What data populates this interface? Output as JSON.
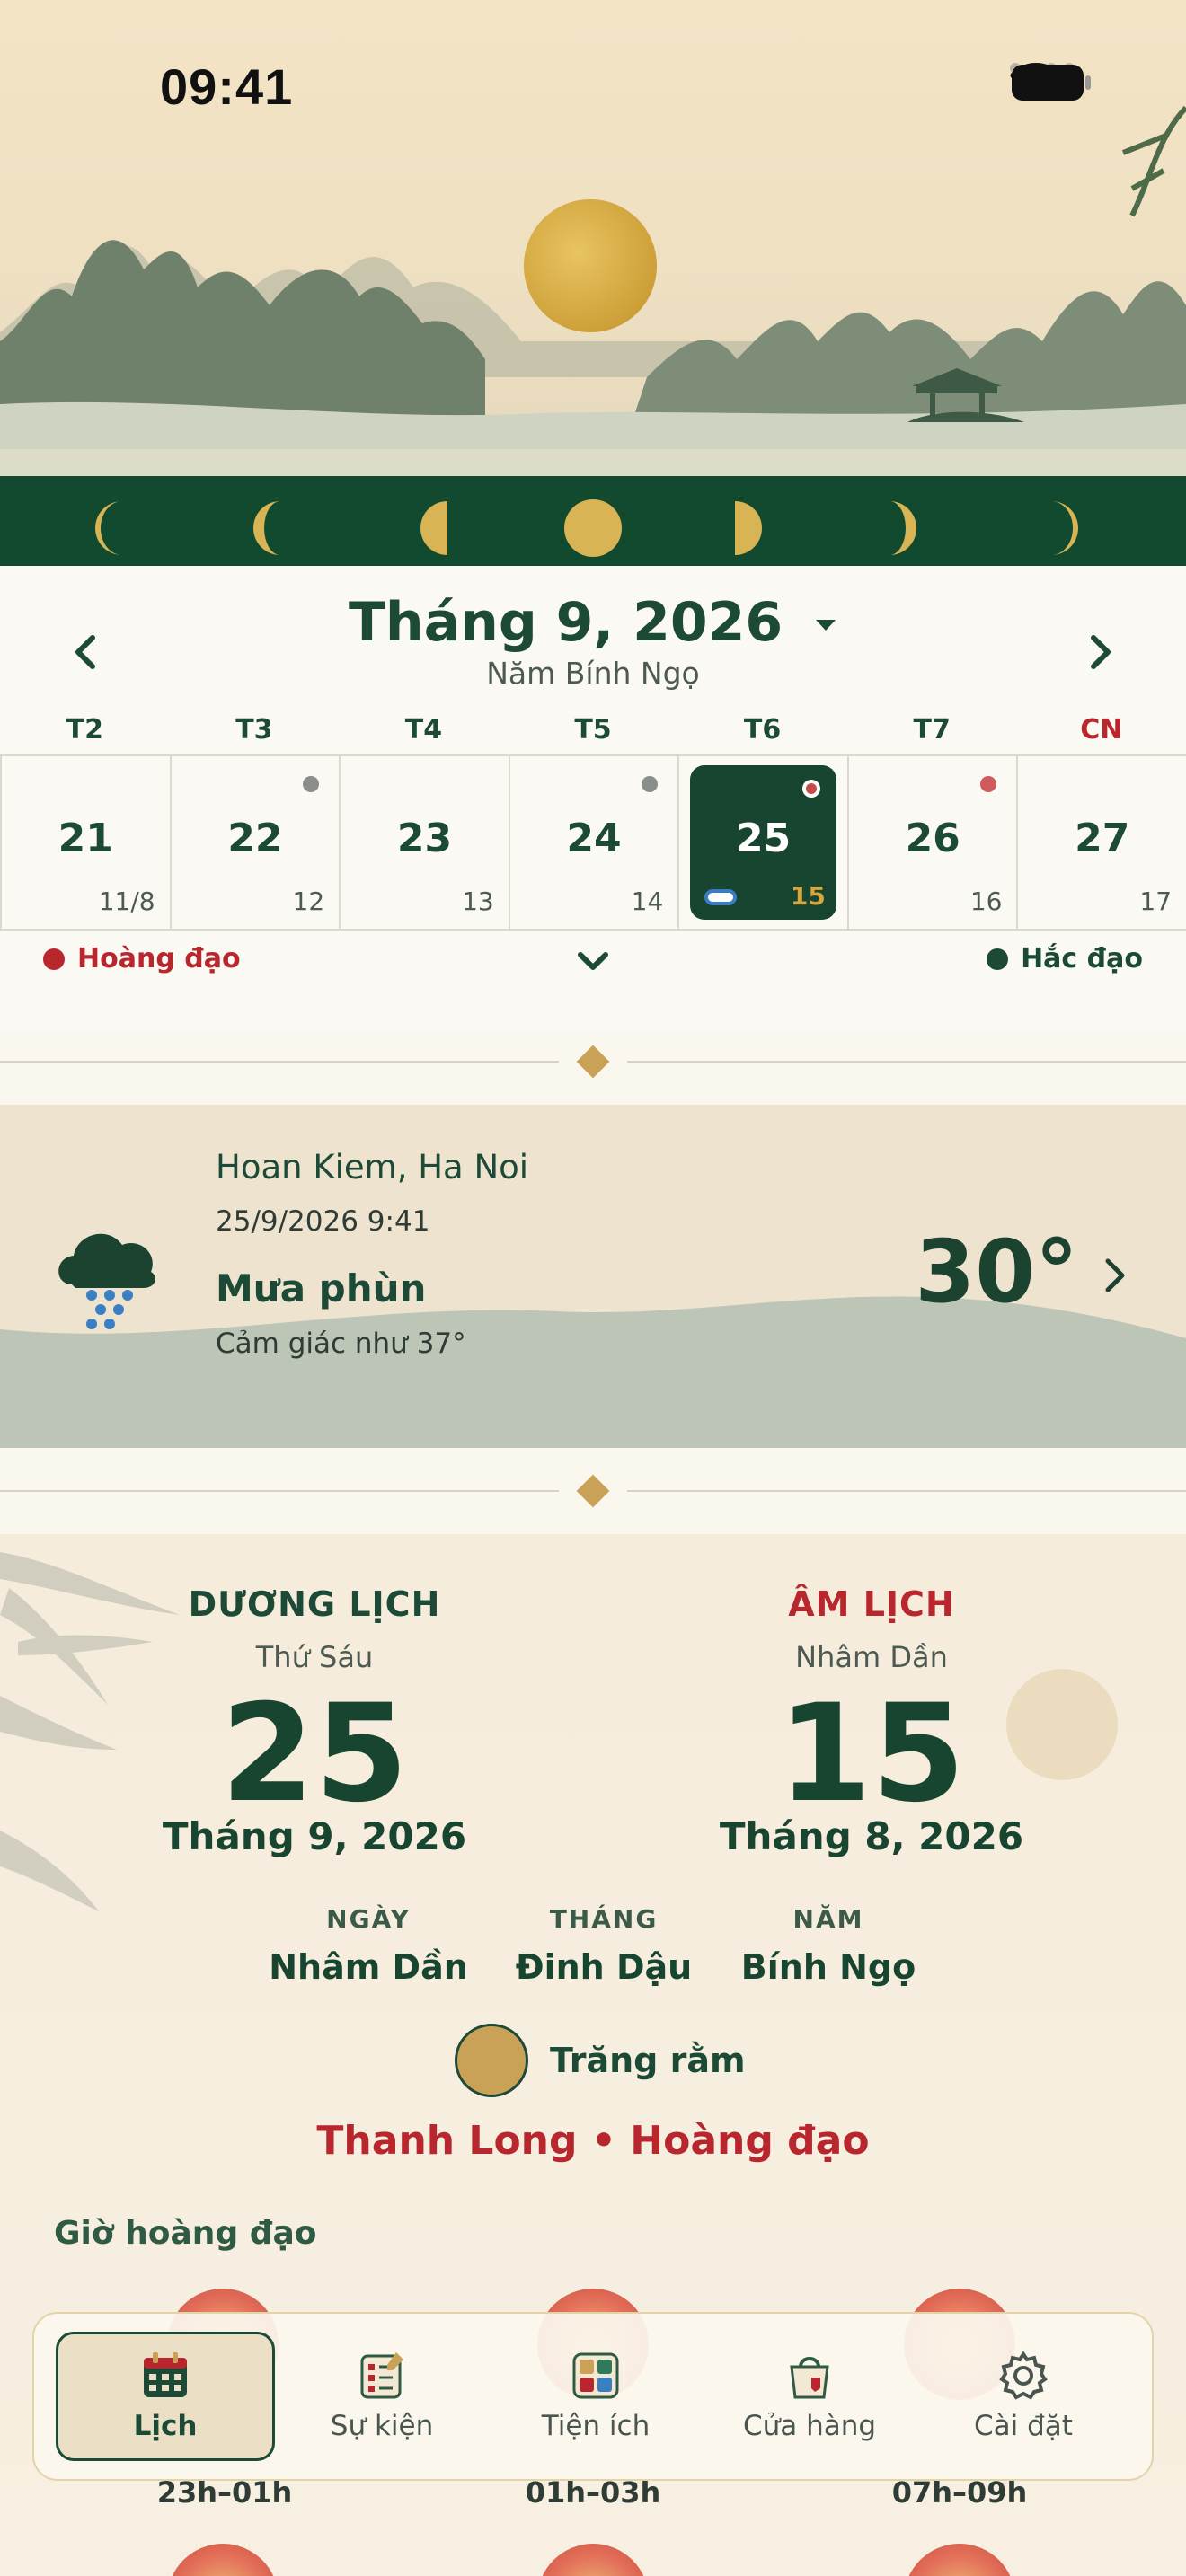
{
  "status_bar": {
    "time": "09:41"
  },
  "calendar": {
    "month_title": "Tháng 9, 2026",
    "year_label": "Năm Bính Ngọ",
    "weekdays": [
      "T2",
      "T3",
      "T4",
      "T5",
      "T6",
      "T7",
      "CN"
    ],
    "days": [
      {
        "day": "21",
        "lunar": "11/8",
        "dot": ""
      },
      {
        "day": "22",
        "lunar": "12",
        "dot": "grey"
      },
      {
        "day": "23",
        "lunar": "13",
        "dot": ""
      },
      {
        "day": "24",
        "lunar": "14",
        "dot": "grey"
      },
      {
        "day": "25",
        "lunar": "15",
        "dot": "red",
        "selected": true
      },
      {
        "day": "26",
        "lunar": "16",
        "dot": "red"
      },
      {
        "day": "27",
        "lunar": "17",
        "dot": ""
      }
    ],
    "legend_good": "Hoàng đạo",
    "legend_bad": "Hắc đạo",
    "colors": {
      "good": "#b8262e",
      "bad": "#1d4a36",
      "accent": "#17452f"
    }
  },
  "weather": {
    "location": "Hoan Kiem, Ha Noi",
    "datetime": "25/9/2026 9:41",
    "condition": "Mưa phùn",
    "feels_like": "Cảm giác như 37°",
    "temperature": "30°",
    "icon": "drizzle-cloud-icon"
  },
  "day_detail": {
    "solar": {
      "header": "DƯƠNG LỊCH",
      "weekday": "Thứ Sáu",
      "day": "25",
      "month_year": "Tháng 9, 2026"
    },
    "lunar": {
      "header": "ÂM LỊCH",
      "can_chi_day": "Nhâm Dần",
      "day": "15",
      "month_year": "Tháng 8, 2026"
    },
    "can_chi": {
      "day_label": "NGÀY",
      "day_value": "Nhâm Dần",
      "month_label": "THÁNG",
      "month_value": "Đinh Dậu",
      "year_label": "NĂM",
      "year_value": "Bính Ngọ"
    },
    "moon_phase": "Trăng rằm",
    "star": "Thanh Long • Hoàng đạo",
    "good_hours_title": "Giờ hoàng đạo",
    "good_hours": [
      "23h–01h",
      "01h–03h",
      "07h–09h"
    ]
  },
  "tabbar": {
    "tabs": [
      {
        "label": "Lịch",
        "icon": "calendar-icon",
        "active": true
      },
      {
        "label": "Sự kiện",
        "icon": "checklist-icon"
      },
      {
        "label": "Tiện ích",
        "icon": "utilities-grid-icon"
      },
      {
        "label": "Cửa hàng",
        "icon": "shopping-bag-icon"
      },
      {
        "label": "Cài đặt",
        "icon": "gear-icon"
      }
    ]
  }
}
